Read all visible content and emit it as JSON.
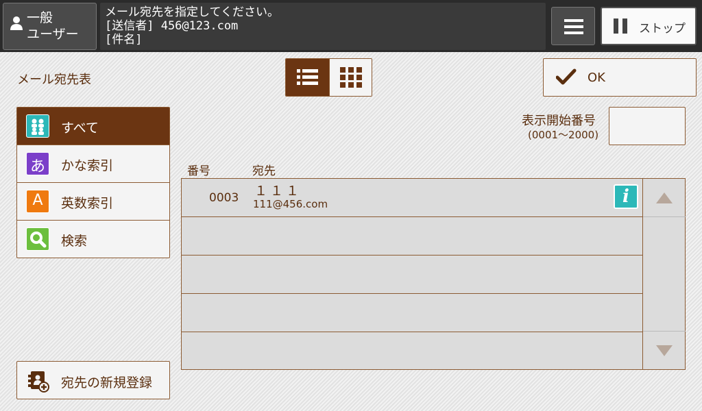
{
  "header": {
    "user_line1": "一般",
    "user_line2": "ユーザー",
    "message_lines": [
      "メール宛先を指定してください。",
      "[送信者] 456@123.com",
      "[件名]"
    ],
    "stop_label": "ストップ"
  },
  "page_title": "メール宛先表",
  "view_toggle": {
    "selected": "list"
  },
  "ok_label": "OK",
  "nav": {
    "items": [
      {
        "label": "すべて",
        "icon": "people-icon",
        "color": "#2cb8b8",
        "active": true
      },
      {
        "label": "かな索引",
        "icon": "hiragana-a-icon",
        "glyph": "あ",
        "color": "#7b3fc9",
        "active": false
      },
      {
        "label": "英数索引",
        "icon": "letter-a-icon",
        "glyph": "A",
        "color": "#ef7a10",
        "active": false
      },
      {
        "label": "検索",
        "icon": "search-icon",
        "color": "#6cbf3e",
        "active": false
      }
    ]
  },
  "start_number": {
    "label": "表示開始番号",
    "range": "(0001～2000)",
    "value": ""
  },
  "table": {
    "columns": [
      "番号",
      "宛先"
    ],
    "rows": [
      {
        "number": "0003",
        "name": "１１１",
        "email": "111@456.com"
      }
    ]
  },
  "new_registration_label": "宛先の新規登録",
  "colors": {
    "accent_brown": "#6b3512",
    "text_brown": "#5a2e0e",
    "info_teal": "#2cb8b8"
  }
}
